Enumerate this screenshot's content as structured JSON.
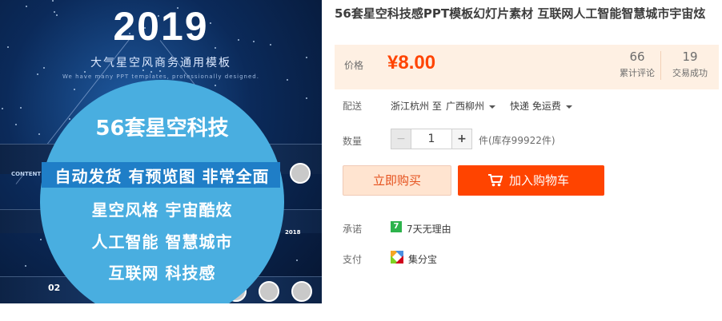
{
  "product": {
    "title": "56套星空科技感PPT模板幻灯片素材 互联网人工智能智慧城市宇宙炫"
  },
  "image": {
    "year": "2019",
    "subtitle": "大气星空风商务通用模板",
    "tagline": "We have many PPT templates, professionally designed.",
    "circle_title": "56套星空科技",
    "circle_lines": [
      "自动发货 有预览图 非常全面",
      "星空风格 宇宙酷炫",
      "人工智能 智慧城市",
      "互联网 科技感"
    ],
    "side_left": "CONTENT",
    "side_bottom": "02",
    "side_right": "2018"
  },
  "price": {
    "label": "价格",
    "value": "¥8.00",
    "reviews_count": "66",
    "reviews_label": "累计评论",
    "deals_count": "19",
    "deals_label": "交易成功"
  },
  "shipping": {
    "label": "配送",
    "from": "浙江杭州 至",
    "to": "广西柳州",
    "method": "快递 免运费"
  },
  "quantity": {
    "label": "数量",
    "minus": "−",
    "value": "1",
    "plus": "+",
    "stock": "件(库存99922件)"
  },
  "actions": {
    "buy_now": "立即购买",
    "add_to_cart": "加入购物车"
  },
  "promise": {
    "label": "承诺",
    "icon_text": "7",
    "text": "7天无理由"
  },
  "payment": {
    "label": "支付",
    "text": "集分宝"
  },
  "colors": {
    "accent": "#ff4400",
    "price": "#ff4400",
    "price_bg": "#fef0e3",
    "promise_green": "#2db34c"
  }
}
